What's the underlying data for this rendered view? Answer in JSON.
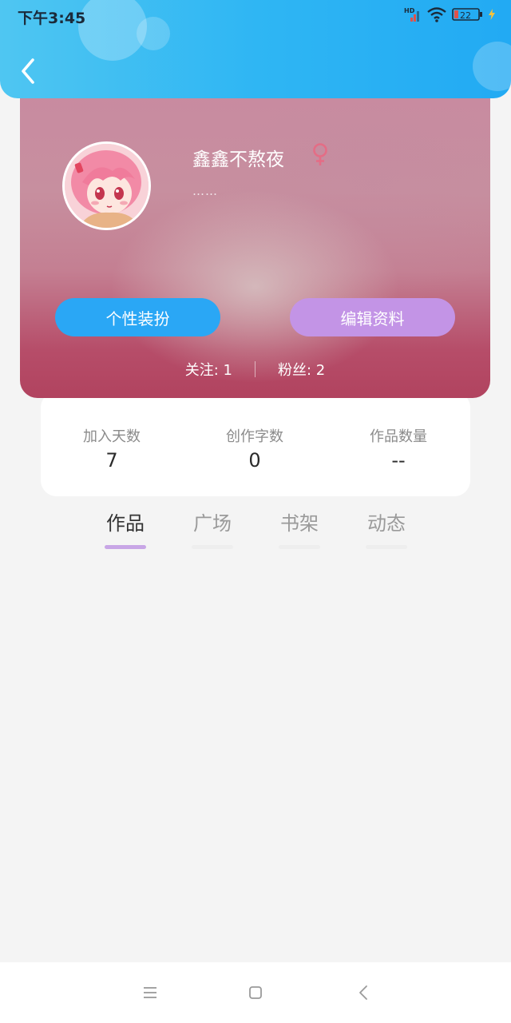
{
  "status_bar": {
    "time": "下午3:45",
    "network_label": "HD",
    "battery_level": "22"
  },
  "profile": {
    "username": "鑫鑫不熬夜",
    "bio": "……",
    "dress_up_label": "个性装扮",
    "edit_profile_label": "编辑资料",
    "following": "关注: 1",
    "followers": "粉丝: 2"
  },
  "stats": [
    {
      "label": "加入天数",
      "value": "7"
    },
    {
      "label": "创作字数",
      "value": "0"
    },
    {
      "label": "作品数量",
      "value": "--"
    }
  ],
  "tabs": [
    {
      "label": "作品",
      "active": true
    },
    {
      "label": "广场",
      "active": false
    },
    {
      "label": "书架",
      "active": false
    },
    {
      "label": "动态",
      "active": false
    }
  ],
  "colors": {
    "header_blue": "#2fb6f3",
    "dress_button": "#2aa7f5",
    "edit_button": "#c394e6",
    "gender_female": "#e46d86",
    "tab_indicator": "#c8a6e6"
  },
  "icons": {
    "back": "chevron-left-icon",
    "gender": "female-icon",
    "nav_menu": "menu-icon",
    "nav_home": "square-home-icon",
    "nav_back": "triangle-back-icon"
  }
}
